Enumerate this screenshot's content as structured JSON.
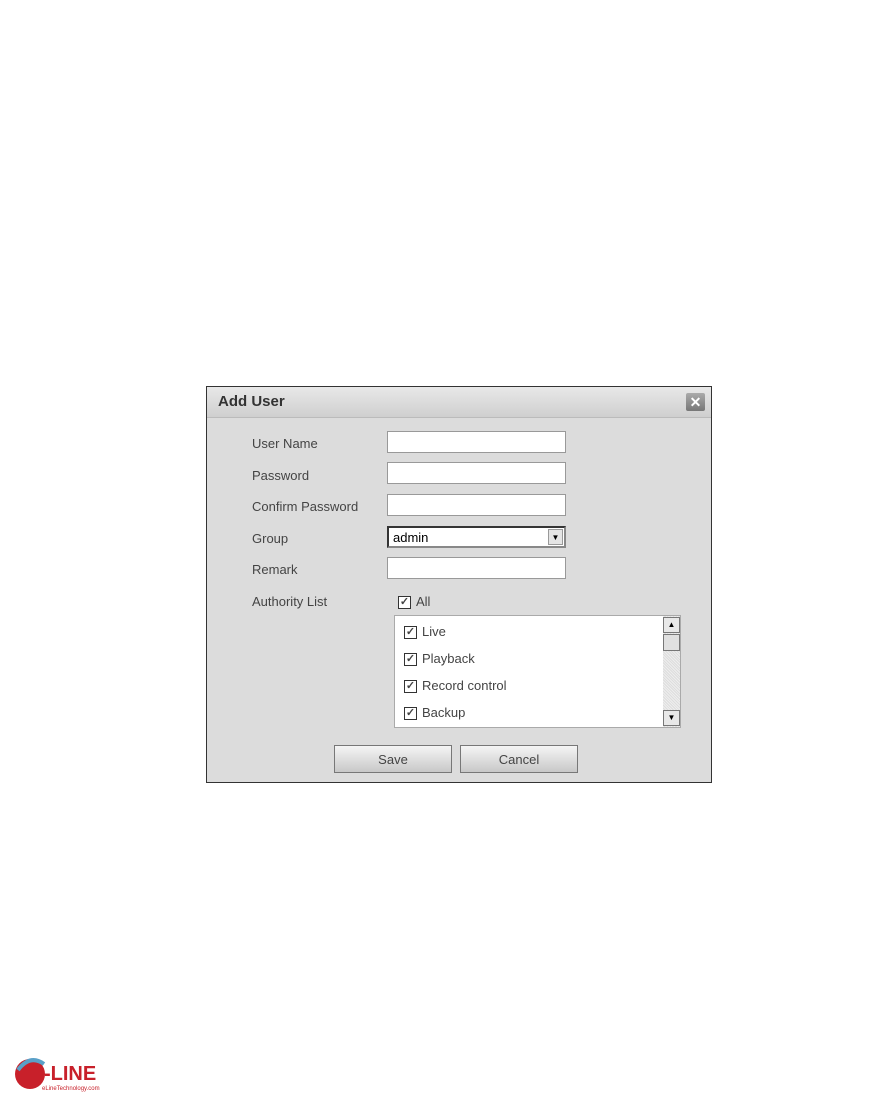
{
  "dialog": {
    "title": "Add User",
    "close_icon": "close-icon"
  },
  "fields": {
    "user_name": {
      "label": "User Name",
      "value": ""
    },
    "password": {
      "label": "Password",
      "value": ""
    },
    "confirm_password": {
      "label": "Confirm Password",
      "value": ""
    },
    "group": {
      "label": "Group",
      "value": "admin"
    },
    "remark": {
      "label": "Remark",
      "value": ""
    }
  },
  "authority": {
    "label": "Authority List",
    "all_label": "All",
    "all_checked": true,
    "items": [
      {
        "label": "Live",
        "checked": true
      },
      {
        "label": "Playback",
        "checked": true
      },
      {
        "label": "Record control",
        "checked": true
      },
      {
        "label": "Backup",
        "checked": true
      }
    ]
  },
  "buttons": {
    "save": "Save",
    "cancel": "Cancel"
  },
  "logo": {
    "text": "e-LINE",
    "subtext": "eLineTechnology.com",
    "color": "#c8202a"
  }
}
